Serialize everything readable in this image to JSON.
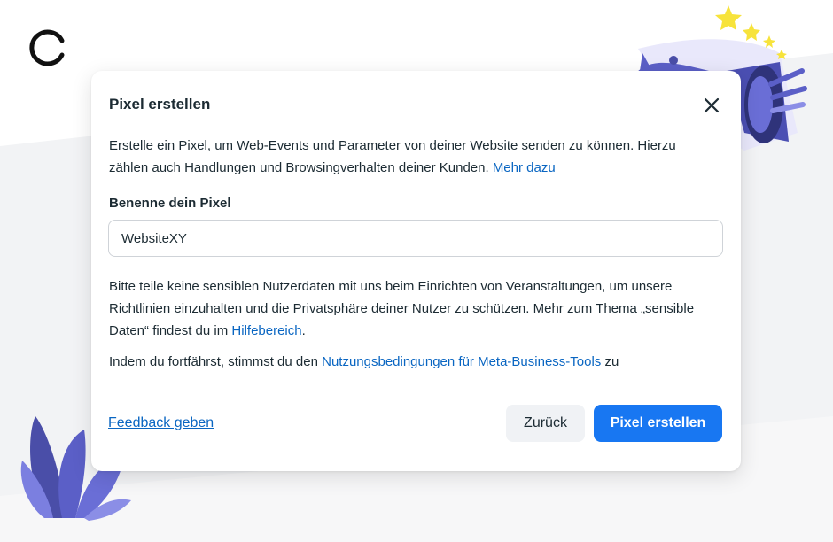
{
  "dialog": {
    "title": "Pixel erstellen",
    "close_icon": "close-icon",
    "intro_text": "Erstelle ein Pixel, um Web-Events und Parameter von deiner Website senden zu können. Hierzu zählen auch Handlungen und Browsingverhalten deiner Kunden. ",
    "intro_link": "Mehr dazu",
    "field_label": "Benenne dein Pixel",
    "field_value": "WebsiteXY",
    "notice_text": "Bitte teile keine sensiblen Nutzerdaten mit uns beim Einrichten von Veranstaltungen, um unsere Richtlinien einzuhalten und die Privatsphäre deiner Nutzer zu schützen. Mehr zum Thema „sensible Daten“ findest du im ",
    "notice_link": "Hilfebereich",
    "notice_end": ".",
    "terms_text": "Indem du fortfährst, stimmst du den ",
    "terms_link": "Nutzungsbedingungen für Meta-Business-Tools",
    "terms_end": " zu",
    "feedback_label": "Feedback geben",
    "back_label": "Zurück",
    "create_label": "Pixel erstellen"
  },
  "decor": {
    "loader_icon": "loading-spinner-icon",
    "megaphone_icon": "megaphone-illustration",
    "plant_icon": "plant-illustration",
    "stars_icon": "stars-icon"
  },
  "colors": {
    "primary": "#1877f2",
    "link": "#0a66c2",
    "illustration_purple": "#5b5fc7",
    "star_yellow": "#f7e33b"
  }
}
